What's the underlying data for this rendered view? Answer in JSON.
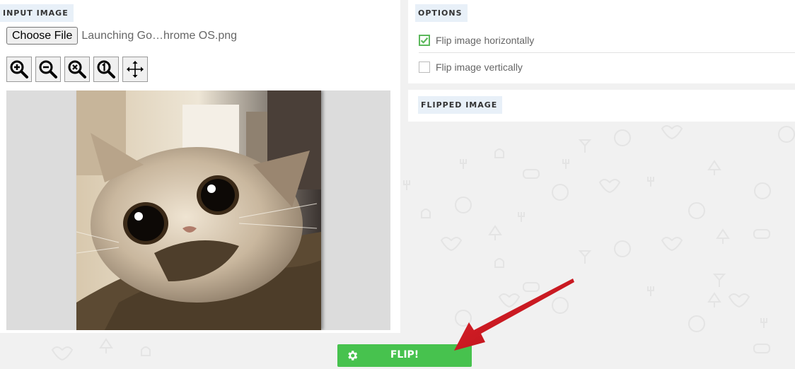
{
  "input_panel": {
    "label": "INPUT IMAGE",
    "choose_file_label": "Choose File",
    "file_name": "Launching Go…hrome OS.png",
    "zoom_tools": [
      {
        "icon": "zoom-in-icon"
      },
      {
        "icon": "zoom-out-icon"
      },
      {
        "icon": "zoom-reset-icon"
      },
      {
        "icon": "zoom-actual-size-icon"
      },
      {
        "icon": "move-icon"
      }
    ]
  },
  "options_panel": {
    "label": "OPTIONS",
    "options": [
      {
        "label": "Flip image horizontally",
        "checked": true
      },
      {
        "label": "Flip image vertically",
        "checked": false
      }
    ]
  },
  "flipped_panel": {
    "label": "FLIPPED IMAGE"
  },
  "flip_button": {
    "label": "FLIP!",
    "icon": "gear-icon"
  },
  "colors": {
    "accent_green": "#47c24e",
    "label_bg": "#e8f0f8",
    "annotation_arrow": "#d8121c"
  }
}
